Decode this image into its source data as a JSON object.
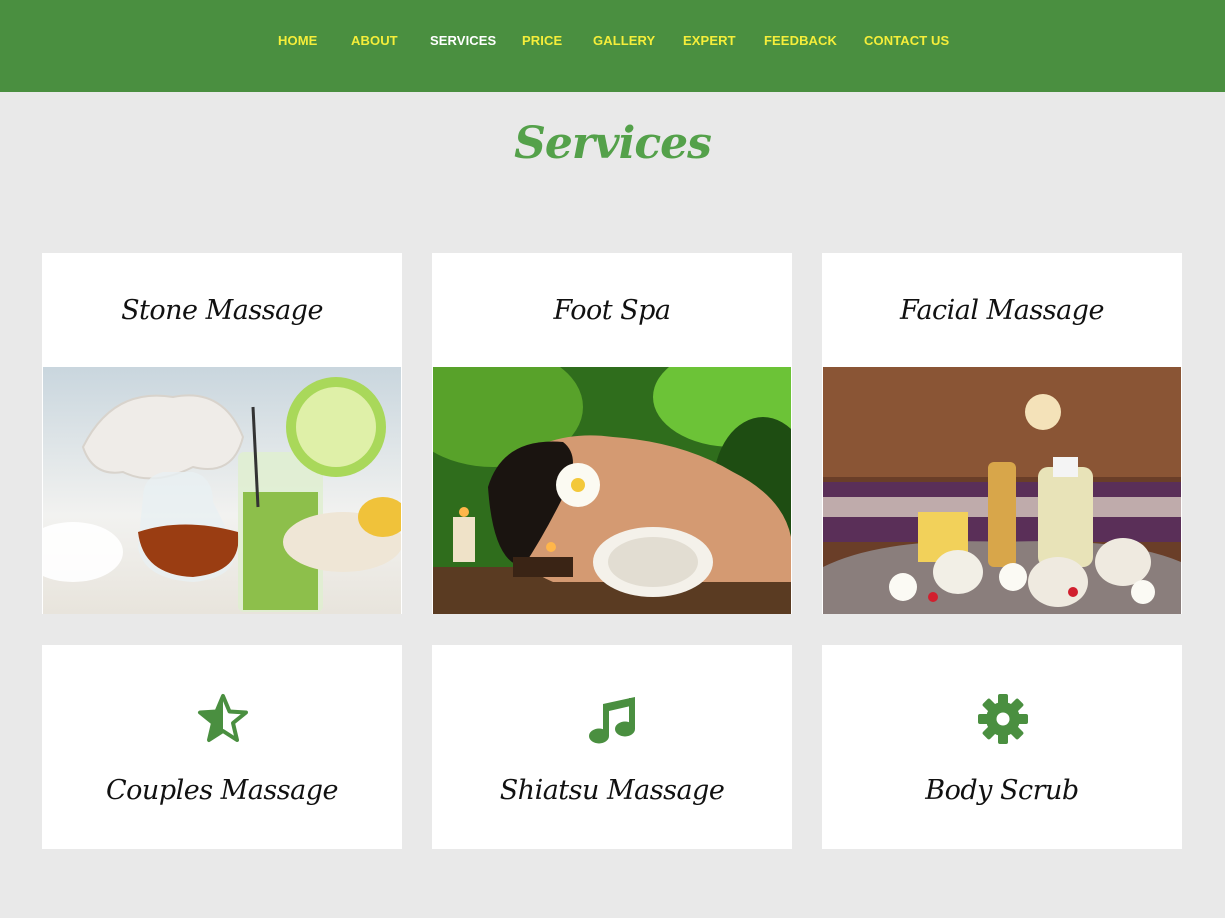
{
  "nav": {
    "items": [
      {
        "label": "HOME",
        "active": false
      },
      {
        "label": "ABOUT",
        "active": false
      },
      {
        "label": "SERVICES",
        "active": true
      },
      {
        "label": "PRICE",
        "active": false
      },
      {
        "label": "GALLERY",
        "active": false
      },
      {
        "label": "EXPERT",
        "active": false
      },
      {
        "label": "FEEDBACK",
        "active": false
      },
      {
        "label": "CONTACT US",
        "active": false
      }
    ]
  },
  "page": {
    "title": "Services"
  },
  "services": {
    "image_cards": [
      {
        "title": "Stone Massage",
        "image": "spa-drinks-and-towel-photo"
      },
      {
        "title": "Foot Spa",
        "image": "woman-relaxing-with-flower-photo"
      },
      {
        "title": "Facial Massage",
        "image": "spa-oils-and-candles-photo"
      }
    ],
    "icon_cards": [
      {
        "title": "Couples Massage",
        "icon": "star-half-icon"
      },
      {
        "title": "Shiatsu Massage",
        "icon": "music-note-icon"
      },
      {
        "title": "Body Scrub",
        "icon": "gear-icon"
      }
    ]
  },
  "colors": {
    "nav_background": "#4a8f40",
    "nav_link": "#f5ee3a",
    "nav_active": "#ffffff",
    "title_green": "#54a14a",
    "icon_green": "#4a8f40",
    "page_background": "#e9e9e9"
  }
}
